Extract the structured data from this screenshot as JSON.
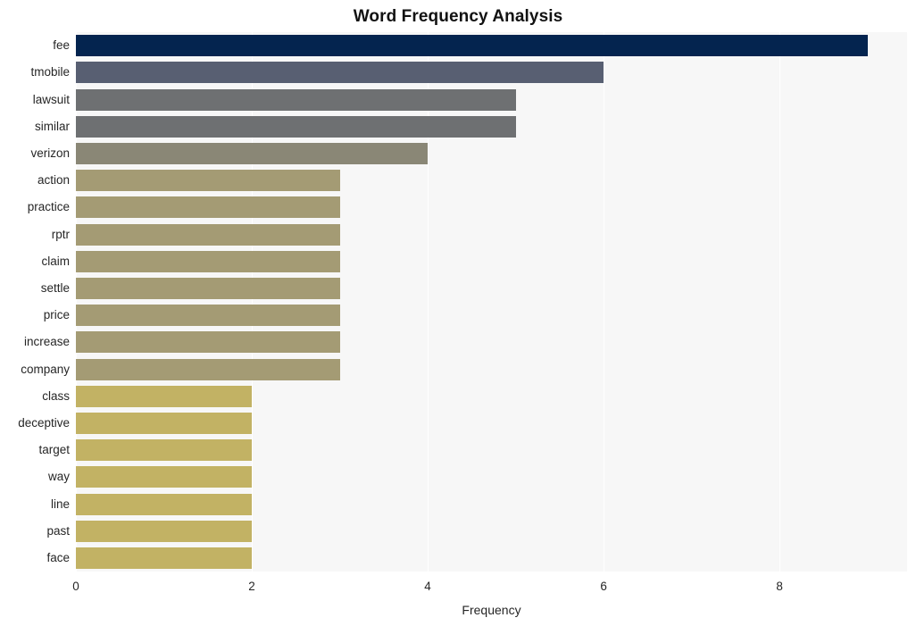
{
  "chart_data": {
    "type": "bar",
    "orientation": "horizontal",
    "title": "Word Frequency Analysis",
    "xlabel": "Frequency",
    "ylabel": "",
    "categories": [
      "fee",
      "tmobile",
      "lawsuit",
      "similar",
      "verizon",
      "action",
      "practice",
      "rptr",
      "claim",
      "settle",
      "price",
      "increase",
      "company",
      "class",
      "deceptive",
      "target",
      "way",
      "line",
      "past",
      "face"
    ],
    "values": [
      9,
      6,
      5,
      5,
      4,
      3,
      3,
      3,
      3,
      3,
      3,
      3,
      3,
      2,
      2,
      2,
      2,
      2,
      2,
      2
    ],
    "bar_colors": [
      "#04244f",
      "#585f72",
      "#6e7072",
      "#6e7072",
      "#8a8776",
      "#a49b74",
      "#a49b74",
      "#a49b74",
      "#a49b74",
      "#a49b74",
      "#a49b74",
      "#a49b74",
      "#a49b74",
      "#c2b264",
      "#c2b264",
      "#c2b264",
      "#c2b264",
      "#c2b264",
      "#c2b264",
      "#c2b264"
    ],
    "xlim": [
      0,
      9.45
    ],
    "x_ticks": [
      0,
      2,
      4,
      6,
      8
    ],
    "x_tick_labels": [
      "0",
      "2",
      "4",
      "6",
      "8"
    ],
    "grid": true,
    "grid_color": "#ffffff",
    "plot_background": "#f7f7f7",
    "figure_background": "#ffffff",
    "legend": null,
    "legend_position": "none"
  },
  "colors": {
    "title_text": "#121212",
    "tick_text": "#262626",
    "axis_title_text": "#262626"
  }
}
